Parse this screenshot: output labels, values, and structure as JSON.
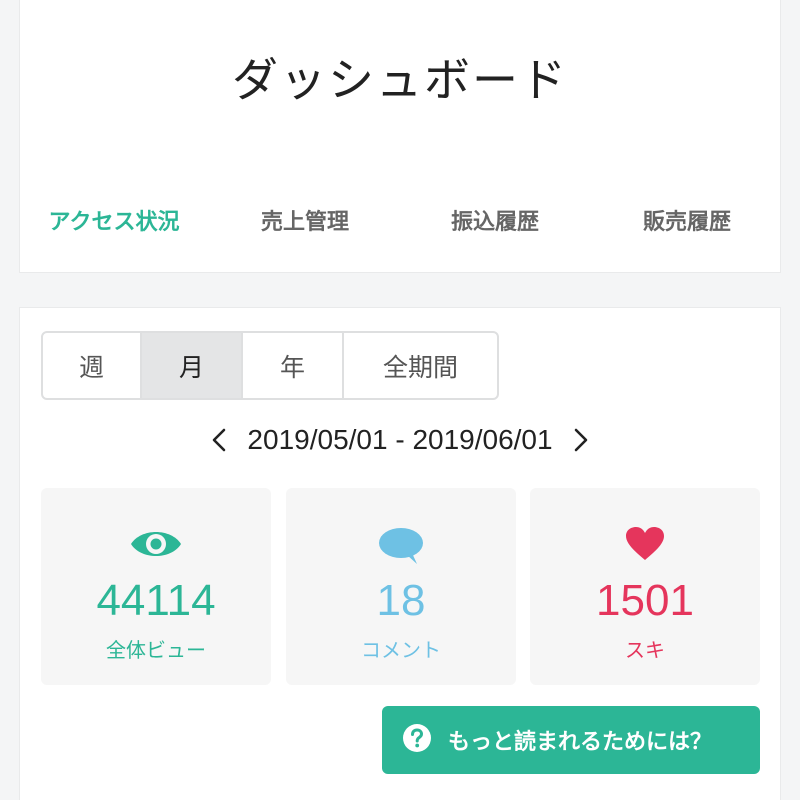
{
  "header": {
    "title": "ダッシュボード",
    "tabs": [
      {
        "label": "アクセス状況",
        "active": true
      },
      {
        "label": "売上管理",
        "active": false
      },
      {
        "label": "振込履歴",
        "active": false
      },
      {
        "label": "販売履歴",
        "active": false
      }
    ]
  },
  "period": {
    "options": [
      "週",
      "月",
      "年",
      "全期間"
    ],
    "selected": "月"
  },
  "date_range": {
    "text": "2019/05/01 - 2019/06/01",
    "prev_icon": "chevron-left-icon",
    "next_icon": "chevron-right-icon"
  },
  "stats": [
    {
      "icon": "eye-icon",
      "value": "44114",
      "label": "全体ビュー",
      "color": "#2cb696"
    },
    {
      "icon": "comment-icon",
      "value": "18",
      "label": "コメント",
      "color": "#6ec1e4"
    },
    {
      "icon": "heart-icon",
      "value": "1501",
      "label": "スキ",
      "color": "#e5355c"
    }
  ],
  "help_button": {
    "label": "もっと読まれるためには？",
    "icon": "question-icon",
    "color": "#2cb696"
  },
  "colors": {
    "accent": "#2cb696",
    "tab_inactive": "#666666"
  }
}
